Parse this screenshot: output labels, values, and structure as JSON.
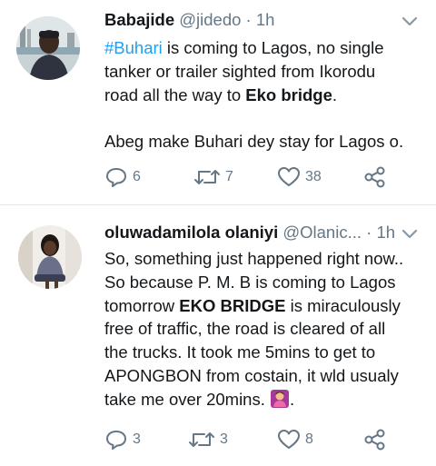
{
  "tweets": [
    {
      "name": "Babajide",
      "handle": "@jidedo",
      "separator": "·",
      "time": "1h",
      "lines": [
        {
          "parts": [
            {
              "text": "#Buhari",
              "style": "hashtag"
            },
            {
              "text": " is coming to Lagos, no single",
              "style": "plain"
            }
          ]
        },
        {
          "parts": [
            {
              "text": "tanker or trailer sighted from Ikorodu",
              "style": "plain"
            }
          ]
        },
        {
          "parts": [
            {
              "text": "road all the way to ",
              "style": "plain"
            },
            {
              "text": "Eko bridge",
              "style": "bold"
            },
            {
              "text": ".",
              "style": "plain"
            }
          ]
        },
        {
          "parts": []
        },
        {
          "parts": [
            {
              "text": "Abeg make Buhari dey stay for Lagos o.",
              "style": "plain"
            }
          ]
        }
      ],
      "replies": "6",
      "retweets": "7",
      "likes": "38"
    },
    {
      "name": "oluwadamilola olaniyi",
      "handle": "@Olanic...",
      "separator": "·",
      "time": "1h",
      "lines": [
        {
          "parts": [
            {
              "text": "So,  something just happened right now..",
              "style": "plain"
            }
          ]
        },
        {
          "parts": [
            {
              "text": "So because P. M. B is coming to Lagos",
              "style": "plain"
            }
          ]
        },
        {
          "parts": [
            {
              "text": "tomorrow ",
              "style": "plain"
            },
            {
              "text": "EKO BRIDGE",
              "style": "bold"
            },
            {
              "text": " is miraculously",
              "style": "plain"
            }
          ]
        },
        {
          "parts": [
            {
              "text": "free of traffic,  the road is cleared of all",
              "style": "plain"
            }
          ]
        },
        {
          "parts": [
            {
              "text": "the trucks. It took me 5mins to get to",
              "style": "plain"
            }
          ]
        },
        {
          "parts": [
            {
              "text": "APONGBON from costain, it wld usualy",
              "style": "plain"
            }
          ]
        },
        {
          "parts": [
            {
              "text": "take me over 20mins. ",
              "style": "plain"
            },
            {
              "text": "",
              "style": "emoji"
            },
            {
              "text": ".",
              "style": "plain"
            }
          ]
        }
      ],
      "replies": "3",
      "retweets": "3",
      "likes": "8"
    }
  ],
  "colors": {
    "text": "#14171a",
    "muted": "#657786",
    "link": "#1da1f2",
    "divider": "#e1e8ed"
  },
  "icons": [
    "chevron-down-icon",
    "reply-icon",
    "retweet-icon",
    "like-icon",
    "share-icon",
    "person-facepalming-emoji"
  ]
}
